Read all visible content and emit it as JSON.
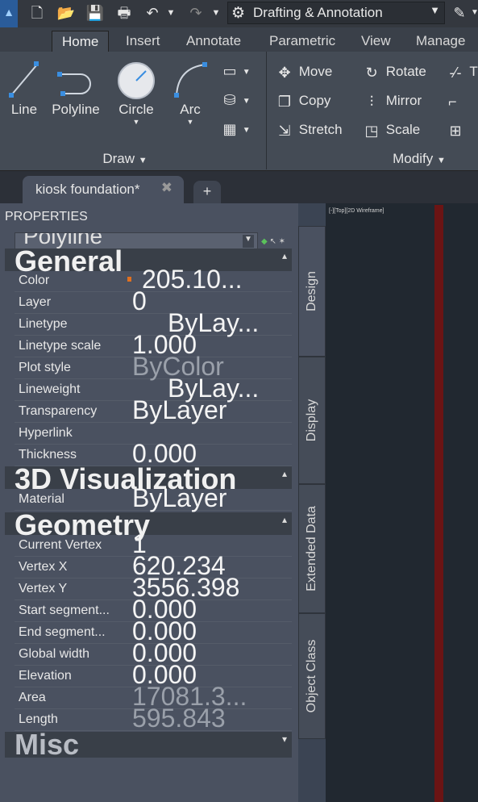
{
  "quick_access": {
    "workspace": "Drafting & Annotation"
  },
  "ribbon_tabs": [
    "Home",
    "Insert",
    "Annotate",
    "Parametric",
    "View",
    "Manage"
  ],
  "draw_panel": {
    "title": "Draw",
    "tools": [
      "Line",
      "Polyline",
      "Circle",
      "Arc"
    ]
  },
  "modify_panel": {
    "title": "Modify",
    "tools": [
      {
        "label": "Move"
      },
      {
        "label": "Rotate"
      },
      {
        "label": "Copy"
      },
      {
        "label": "Mirror"
      },
      {
        "label": "Stretch"
      },
      {
        "label": "Scale"
      }
    ]
  },
  "file_tab": {
    "name": "kiosk foundation*"
  },
  "properties": {
    "title": "PROPERTIES",
    "selected_type": "Polyline",
    "general": {
      "title": "General",
      "rows": [
        {
          "key": "Color",
          "value": "205.10..."
        },
        {
          "key": "Layer",
          "value": "0"
        },
        {
          "key": "Linetype",
          "value": "ByLay..."
        },
        {
          "key": "Linetype scale",
          "value": "1.000"
        },
        {
          "key": "Plot style",
          "value": "ByColor"
        },
        {
          "key": "Lineweight",
          "value": "ByLay..."
        },
        {
          "key": "Transparency",
          "value": "ByLayer"
        },
        {
          "key": "Hyperlink",
          "value": ""
        },
        {
          "key": "Thickness",
          "value": "0.000"
        }
      ]
    },
    "visualization": {
      "title": "3D Visualization",
      "rows": [
        {
          "key": "Material",
          "value": "ByLayer"
        }
      ]
    },
    "geometry": {
      "title": "Geometry",
      "rows": [
        {
          "key": "Current Vertex",
          "value": "1"
        },
        {
          "key": "Vertex X",
          "value": "620.234"
        },
        {
          "key": "Vertex Y",
          "value": "3556.398"
        },
        {
          "key": "Start segment...",
          "value": "0.000"
        },
        {
          "key": "End segment...",
          "value": "0.000"
        },
        {
          "key": "Global width",
          "value": "0.000"
        },
        {
          "key": "Elevation",
          "value": "0.000"
        },
        {
          "key": "Area",
          "value": "17081.3..."
        },
        {
          "key": "Length",
          "value": "595.843"
        }
      ]
    },
    "misc": {
      "title": "Misc"
    }
  },
  "side_tabs": [
    "Design",
    "Display",
    "Extended Data",
    "Object Class"
  ],
  "viewport_label": "[-][Top][2D Wireframe]",
  "colors": {
    "layer_color_swatch": "#e07020",
    "canvas_background": "#212830"
  }
}
